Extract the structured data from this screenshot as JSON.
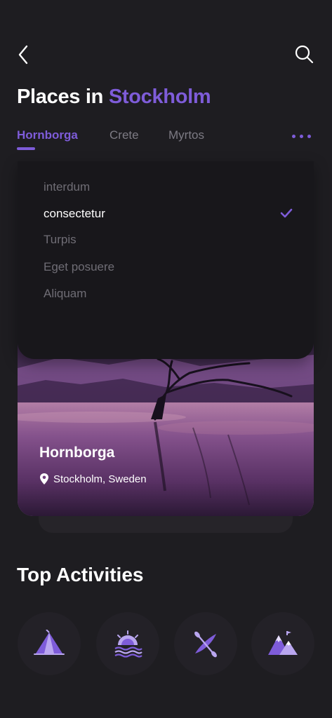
{
  "header": {
    "title_prefix": "Places in",
    "title_accent": "Stockholm"
  },
  "tabs": [
    {
      "label": "Hornborga",
      "active": true
    },
    {
      "label": "Crete",
      "active": false
    },
    {
      "label": "Myrtos",
      "active": false
    }
  ],
  "dropdown": {
    "options": [
      "interdum",
      "consectetur",
      "Turpis",
      "Eget posuere",
      "Aliquam"
    ],
    "selected": "consectetur"
  },
  "place_card": {
    "name": "Hornborga",
    "location": "Stockholm, Sweden"
  },
  "activities": {
    "title": "Top Activities",
    "items": [
      "tent-icon",
      "sunset-icon",
      "kayak-icon",
      "mountain-icon"
    ]
  },
  "colors": {
    "accent": "#7e5cd9",
    "background": "#1e1d21",
    "dropdown_bg": "#18171b",
    "muted_text": "#7d7b84"
  }
}
